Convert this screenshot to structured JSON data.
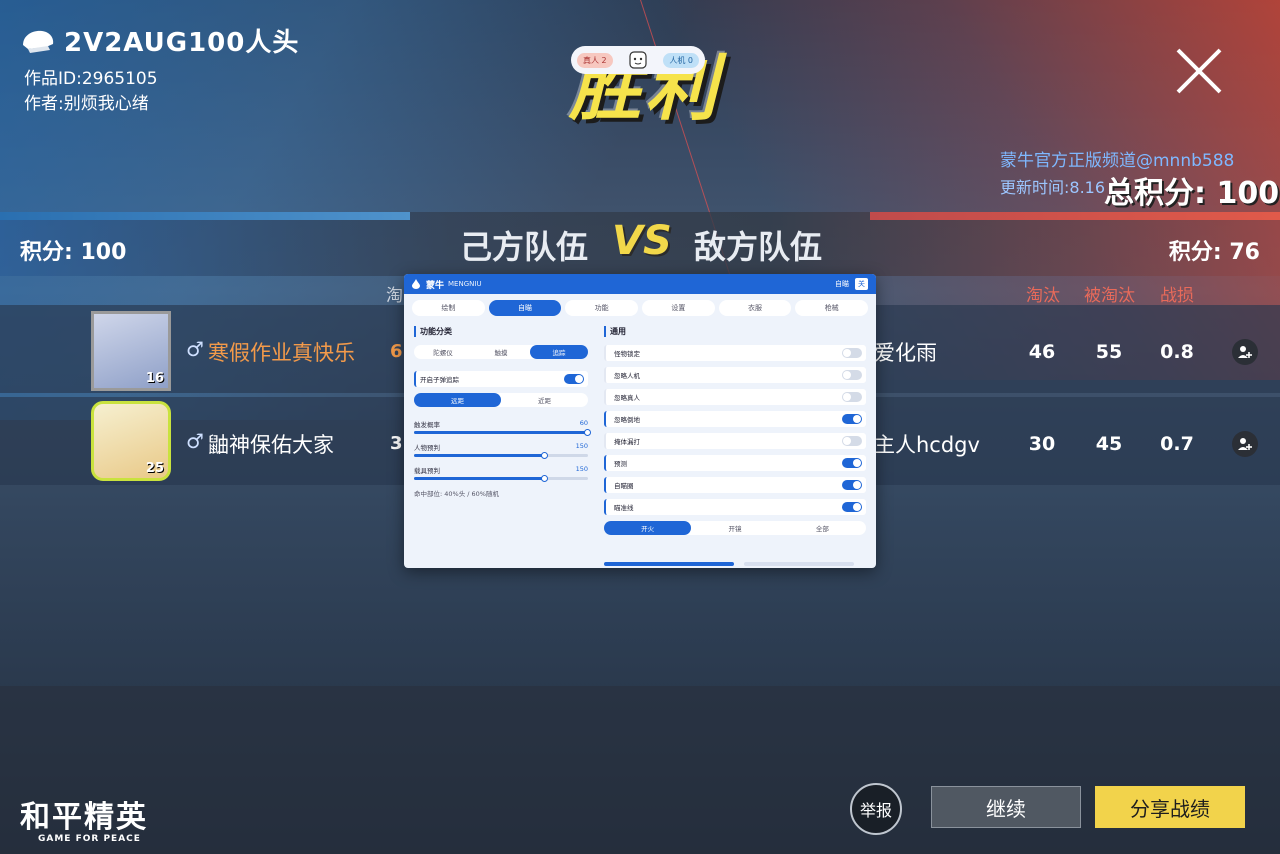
{
  "header": {
    "mode_title": "2V2AUG100人头",
    "work_id": "作品ID:2965105",
    "author": "作者:别烦我心绪",
    "victory_text": "胜利",
    "live": {
      "real_players": "真人 2",
      "bots": "人机 0"
    },
    "channel": "蒙牛官方正版频道@mnnb588",
    "update_time": "更新时间:8.16",
    "total_score": "总积分: 100"
  },
  "scoreboard": {
    "left_score": "积分: 100",
    "right_score": "积分: 76",
    "own_team": "己方队伍",
    "vs": "VS",
    "enemy_team": "敌方队伍",
    "left_col_head": "淘",
    "columns": [
      "淘汰",
      "被淘汰",
      "战损"
    ],
    "rows": [
      {
        "level": "16",
        "gender": "♂",
        "name": "寒假作业真快乐",
        "left_stat": "6",
        "enemy_name": "爱化雨",
        "stats": [
          "46",
          "55",
          "0.8"
        ]
      },
      {
        "level": "25",
        "gender": "♂",
        "name": "鼬神保佑大家",
        "left_stat": "3",
        "enemy_name": "主人hcdgv",
        "stats": [
          "30",
          "45",
          "0.7"
        ]
      }
    ]
  },
  "panel": {
    "brand": "蒙牛",
    "brand_sub": "MENGNIU",
    "head_right": "自瞄",
    "head_box": "关",
    "tabs": [
      "绘制",
      "自瞄",
      "功能",
      "设置",
      "衣服",
      "枪械"
    ],
    "left_title": "功能分类",
    "left_seg": [
      "陀螺仪",
      "触摸",
      "追踪"
    ],
    "open_tracking": "开启子弹追踪",
    "range_seg": [
      "远距",
      "近距"
    ],
    "sliders": [
      {
        "label": "触发概率",
        "value": "60",
        "pct": 1.0
      },
      {
        "label": "人物预判",
        "value": "150",
        "pct": 0.75
      },
      {
        "label": "载具预判",
        "value": "150",
        "pct": 0.75
      }
    ],
    "hit_note": "命中部位: 40%头 / 60%随机",
    "right_title": "通用",
    "right_items": [
      {
        "label": "怪物锁定",
        "on": false
      },
      {
        "label": "忽略人机",
        "on": false
      },
      {
        "label": "忽略真人",
        "on": false
      },
      {
        "label": "忽略倒地",
        "on": true
      },
      {
        "label": "掩体漏打",
        "on": false
      },
      {
        "label": "预测",
        "on": true
      },
      {
        "label": "自瞄圈",
        "on": true
      },
      {
        "label": "瞄准线",
        "on": true
      }
    ],
    "fire_seg": [
      "开火",
      "开镜",
      "全部"
    ]
  },
  "footer": {
    "logo_cn": "和平精英",
    "logo_en": "GAME FOR PEACE",
    "report": "举报",
    "continue": "继续",
    "share": "分享战绩"
  },
  "colors": {
    "accent_blue": "#1f66d6",
    "gold": "#f2d34b",
    "orange_name": "#f39a4a",
    "red_head": "#e86a5a"
  }
}
